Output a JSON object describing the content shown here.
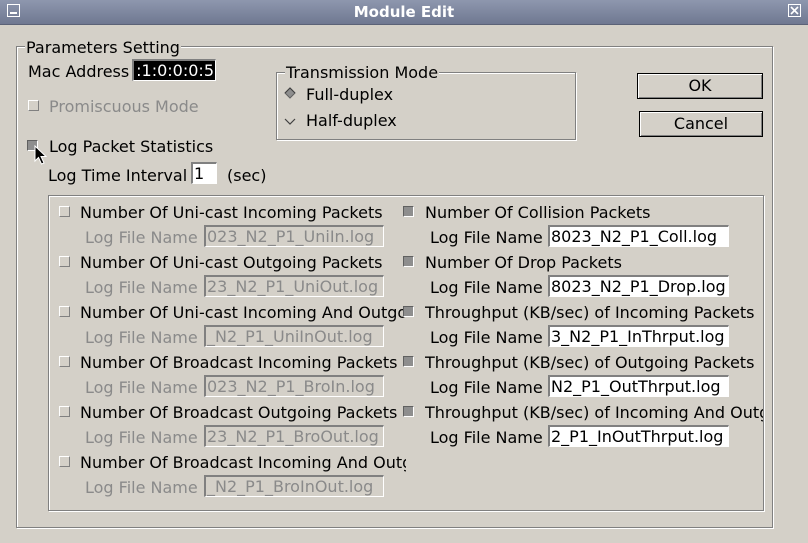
{
  "window": {
    "title": "Module Edit"
  },
  "params": {
    "legend": "Parameters Setting",
    "mac_label": "Mac Address",
    "mac_value": ":1:0:0:0:5",
    "promiscuous_label": "Promiscuous Mode",
    "log_stats_label": "Log Packet Statistics",
    "log_interval_label": "Log Time Interval",
    "log_interval_value": "1",
    "log_interval_unit": "(sec)",
    "file_name_label": "Log File Name"
  },
  "transmission": {
    "legend": "Transmission Mode",
    "full": "Full-duplex",
    "half": "Half-duplex",
    "selected": "Full-duplex"
  },
  "buttons": {
    "ok": "OK",
    "cancel": "Cancel"
  },
  "stats_left": [
    {
      "label": "Number Of Uni-cast Incoming Packets",
      "file": "023_N2_P1_UniIn.log",
      "checked": false
    },
    {
      "label": "Number Of Uni-cast Outgoing Packets",
      "file": "23_N2_P1_UniOut.log",
      "checked": false
    },
    {
      "label": "Number Of Uni-cast Incoming And Outgo",
      "file": "_N2_P1_UniInOut.log",
      "checked": false
    },
    {
      "label": "Number Of Broadcast Incoming Packets",
      "file": "023_N2_P1_BroIn.log",
      "checked": false
    },
    {
      "label": "Number Of Broadcast Outgoing Packets",
      "file": "23_N2_P1_BroOut.log",
      "checked": false
    },
    {
      "label": "Number Of Broadcast Incoming And Outg",
      "file": "_N2_P1_BroInOut.log",
      "checked": false
    }
  ],
  "stats_right": [
    {
      "label": "Number Of Collision Packets",
      "file": "8023_N2_P1_Coll.log",
      "checked": true
    },
    {
      "label": "Number Of Drop Packets",
      "file": "8023_N2_P1_Drop.log",
      "checked": true
    },
    {
      "label": "Throughput (KB/sec) of Incoming Packets",
      "file": "3_N2_P1_InThrput.log",
      "checked": true
    },
    {
      "label": "Throughput (KB/sec) of Outgoing Packets",
      "file": "N2_P1_OutThrput.log",
      "checked": true
    },
    {
      "label": "Throughput (KB/sec) of Incoming And Outg",
      "file": "2_P1_InOutThrput.log",
      "checked": true
    }
  ]
}
